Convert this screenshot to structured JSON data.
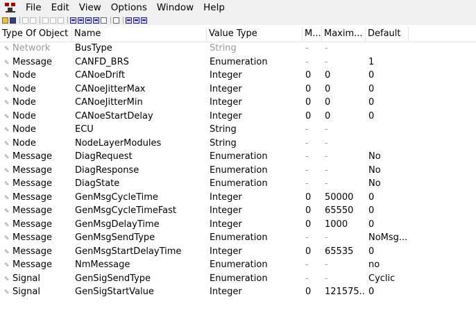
{
  "menu": [
    "File",
    "Edit",
    "View",
    "Options",
    "Window",
    "Help"
  ],
  "toolbar": {
    "icons": [
      "open-icon",
      "save-icon",
      "cut-icon",
      "copy-icon",
      "paste-icon",
      "delete-icon",
      "properties-icon",
      "view1-icon",
      "view2-icon",
      "view3-icon",
      "view4-icon",
      "view5-icon",
      "find-icon",
      "tile-icon",
      "cascade-icon",
      "window-icon"
    ]
  },
  "columns": {
    "type": "Type Of Object",
    "name": "Name",
    "vtype": "Value Type",
    "min": "M...",
    "max": "Maxim...",
    "def": "Default"
  },
  "rows": [
    {
      "type": "Network",
      "name": "BusType",
      "vtype": "String",
      "min": "-",
      "max": "-",
      "def": "",
      "dim": true
    },
    {
      "type": "Message",
      "name": "CANFD_BRS",
      "vtype": "Enumeration",
      "min": "-",
      "max": "-",
      "def": "1"
    },
    {
      "type": "Node",
      "name": "CANoeDrift",
      "vtype": "Integer",
      "min": "0",
      "max": "0",
      "def": "0"
    },
    {
      "type": "Node",
      "name": "CANoeJitterMax",
      "vtype": "Integer",
      "min": "0",
      "max": "0",
      "def": "0"
    },
    {
      "type": "Node",
      "name": "CANoeJitterMin",
      "vtype": "Integer",
      "min": "0",
      "max": "0",
      "def": "0"
    },
    {
      "type": "Node",
      "name": "CANoeStartDelay",
      "vtype": "Integer",
      "min": "0",
      "max": "0",
      "def": "0"
    },
    {
      "type": "Node",
      "name": "ECU",
      "vtype": "String",
      "min": "-",
      "max": "-",
      "def": ""
    },
    {
      "type": "Node",
      "name": "NodeLayerModules",
      "vtype": "String",
      "min": "-",
      "max": "-",
      "def": ""
    },
    {
      "type": "Message",
      "name": "DiagRequest",
      "vtype": "Enumeration",
      "min": "-",
      "max": "-",
      "def": "No"
    },
    {
      "type": "Message",
      "name": "DiagResponse",
      "vtype": "Enumeration",
      "min": "-",
      "max": "-",
      "def": "No"
    },
    {
      "type": "Message",
      "name": "DiagState",
      "vtype": "Enumeration",
      "min": "-",
      "max": "-",
      "def": "No"
    },
    {
      "type": "Message",
      "name": "GenMsgCycleTime",
      "vtype": "Integer",
      "min": "0",
      "max": "50000",
      "def": "0"
    },
    {
      "type": "Message",
      "name": "GenMsgCycleTimeFast",
      "vtype": "Integer",
      "min": "0",
      "max": "65550",
      "def": "0"
    },
    {
      "type": "Message",
      "name": "GenMsgDelayTime",
      "vtype": "Integer",
      "min": "0",
      "max": "1000",
      "def": "0"
    },
    {
      "type": "Message",
      "name": "GenMsgSendType",
      "vtype": "Enumeration",
      "min": "-",
      "max": "-",
      "def": "NoMsg..."
    },
    {
      "type": "Message",
      "name": "GenMsgStartDelayTime",
      "vtype": "Integer",
      "min": "0",
      "max": "65535",
      "def": "0"
    },
    {
      "type": "Message",
      "name": "NmMessage",
      "vtype": "Enumeration",
      "min": "-",
      "max": "-",
      "def": "no"
    },
    {
      "type": "Signal",
      "name": "GenSigSendType",
      "vtype": "Enumeration",
      "min": "-",
      "max": "-",
      "def": "Cyclic"
    },
    {
      "type": "Signal",
      "name": "GenSigStartValue",
      "vtype": "Integer",
      "min": "0",
      "max": "121575...",
      "def": "0"
    }
  ]
}
